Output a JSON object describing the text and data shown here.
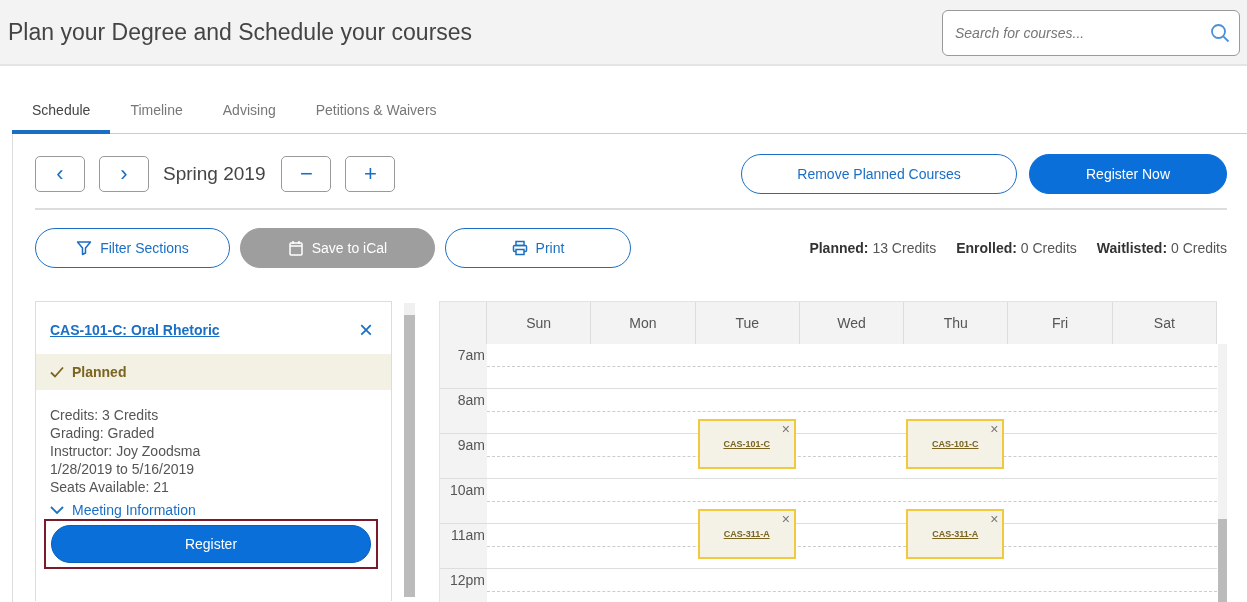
{
  "header": {
    "title": "Plan your Degree and Schedule your courses",
    "search": {
      "placeholder": "Search for courses..."
    }
  },
  "tabs": [
    {
      "label": "Schedule",
      "selected": true
    },
    {
      "label": "Timeline",
      "selected": false
    },
    {
      "label": "Advising",
      "selected": false
    },
    {
      "label": "Petitions & Waivers",
      "selected": false
    }
  ],
  "term": {
    "label": "Spring 2019",
    "prev": "‹",
    "next": "›",
    "remove": "−",
    "add": "+"
  },
  "actions": [
    {
      "label": "Remove Planned Courses",
      "kind": "outline"
    },
    {
      "label": "Register Now",
      "kind": "primary"
    }
  ],
  "tools": [
    {
      "label": "Filter Sections",
      "disabled": false
    },
    {
      "label": "Save to iCal",
      "disabled": true
    },
    {
      "label": "Print",
      "disabled": false
    }
  ],
  "totals": [
    "**Planned:** 13 Credits",
    "**Enrolled:** 0 Credits",
    "**Waitlisted:** 0 Credits"
  ],
  "course": {
    "title": "CAS-101-C: Oral Rhetoric",
    "close": "×",
    "status": "Planned",
    "details": [
      "Credits: 3 Credits",
      "Grading: Graded",
      "Instructor: Joy Zoodsma",
      "1/28/2019 to 5/16/2019",
      "Seats Available:  21"
    ],
    "meeting": "Meeting Information",
    "meeting_expanded": false,
    "register": "Register",
    "highlighted": true
  },
  "calendar": {
    "days": [
      "Sun",
      "Mon",
      "Tue",
      "Wed",
      "Thu",
      "Fri",
      "Sat"
    ],
    "hours": [
      {
        "label": "7am",
        "slots": [
          {
            "kind": "empty"
          },
          {
            "kind": "empty"
          },
          {
            "kind": "empty"
          },
          {
            "kind": "empty"
          },
          {
            "kind": "empty"
          },
          {
            "kind": "empty"
          },
          {
            "kind": "empty"
          }
        ]
      },
      {
        "label": "8am",
        "slots": [
          {
            "kind": "empty"
          },
          {
            "kind": "empty"
          },
          {
            "kind": "empty"
          },
          {
            "kind": "empty"
          },
          {
            "kind": "empty"
          },
          {
            "kind": "empty"
          },
          {
            "kind": "empty"
          }
        ]
      },
      {
        "label": "9am",
        "slots": [
          {
            "kind": "empty"
          },
          {
            "kind": "empty"
          },
          {
            "kind": "event",
            "course": "CAS-101-C",
            "close": "×"
          },
          {
            "kind": "empty"
          },
          {
            "kind": "event",
            "course": "CAS-101-C",
            "close": "×"
          },
          {
            "kind": "empty"
          },
          {
            "kind": "empty"
          }
        ]
      },
      {
        "label": "10am",
        "slots": [
          {
            "kind": "empty"
          },
          {
            "kind": "empty"
          },
          {
            "kind": "empty"
          },
          {
            "kind": "empty"
          },
          {
            "kind": "empty"
          },
          {
            "kind": "empty"
          },
          {
            "kind": "empty"
          }
        ]
      },
      {
        "label": "11am",
        "slots": [
          {
            "kind": "empty"
          },
          {
            "kind": "empty"
          },
          {
            "kind": "event",
            "course": "CAS-311-A",
            "close": "×"
          },
          {
            "kind": "empty"
          },
          {
            "kind": "event",
            "course": "CAS-311-A",
            "close": "×"
          },
          {
            "kind": "empty"
          },
          {
            "kind": "empty"
          }
        ]
      },
      {
        "label": "12pm",
        "slots": [
          {
            "kind": "empty"
          },
          {
            "kind": "empty"
          },
          {
            "kind": "empty"
          },
          {
            "kind": "empty"
          },
          {
            "kind": "empty"
          },
          {
            "kind": "empty"
          },
          {
            "kind": "empty"
          }
        ]
      }
    ]
  }
}
